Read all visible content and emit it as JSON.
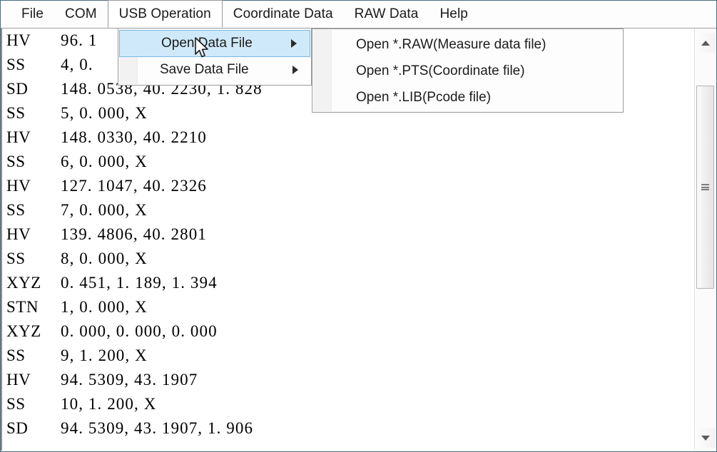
{
  "window": {
    "frame_color": "#4a6b80"
  },
  "menubar": {
    "items": [
      {
        "label": "File",
        "state": "normal"
      },
      {
        "label": "COM",
        "state": "normal"
      },
      {
        "label": "USB Operation",
        "state": "open"
      },
      {
        "label": "Coordinate Data",
        "state": "normal"
      },
      {
        "label": "RAW Data",
        "state": "normal"
      },
      {
        "label": "Help",
        "state": "normal"
      }
    ]
  },
  "dropdown": {
    "owner": "USB Operation",
    "highlight_bg": "#cfe9fa",
    "highlight_border": "#7ab8e0",
    "items": [
      {
        "label": "Open Data File",
        "has_submenu": true,
        "highlighted": true,
        "arrow": "chevron-right-icon"
      },
      {
        "label": "Save Data File",
        "has_submenu": true,
        "highlighted": false,
        "arrow": "chevron-right-icon"
      }
    ]
  },
  "submenu": {
    "owner": "Open Data File",
    "items": [
      {
        "label": "Open *.RAW(Measure data file)"
      },
      {
        "label": "Open *.PTS(Coordinate file)"
      },
      {
        "label": "Open *.LIB(Pcode file)"
      }
    ]
  },
  "data_list": {
    "rows": [
      {
        "tag": "HV",
        "value": "96. 1"
      },
      {
        "tag": "SS",
        "value": "4, 0."
      },
      {
        "tag": "SD",
        "value": "148. 0538, 40. 2230, 1. 828"
      },
      {
        "tag": "SS",
        "value": "5, 0. 000, X"
      },
      {
        "tag": "HV",
        "value": "148. 0330, 40. 2210"
      },
      {
        "tag": "SS",
        "value": "6, 0. 000, X"
      },
      {
        "tag": "HV",
        "value": "127. 1047, 40. 2326"
      },
      {
        "tag": "SS",
        "value": "7, 0. 000, X"
      },
      {
        "tag": "HV",
        "value": "139. 4806, 40. 2801"
      },
      {
        "tag": "SS",
        "value": "8, 0. 000, X"
      },
      {
        "tag": "XYZ",
        "value": "0. 451, 1. 189, 1. 394"
      },
      {
        "tag": "STN",
        "value": "1, 0. 000, X"
      },
      {
        "tag": "XYZ",
        "value": "0. 000, 0. 000, 0. 000"
      },
      {
        "tag": "SS",
        "value": "9, 1. 200, X"
      },
      {
        "tag": "HV",
        "value": "94. 5309, 43. 1907"
      },
      {
        "tag": "SS",
        "value": "10, 1. 200, X"
      },
      {
        "tag": "SD",
        "value": "94. 5309, 43. 1907, 1. 906"
      }
    ]
  },
  "scrollbar": {
    "up_arrow": "triangle-up-icon",
    "down_arrow": "triangle-down-icon",
    "thumb": "scroll-thumb",
    "grip": "grip-lines-icon"
  },
  "cursor": {
    "type": "arrow-cursor"
  }
}
